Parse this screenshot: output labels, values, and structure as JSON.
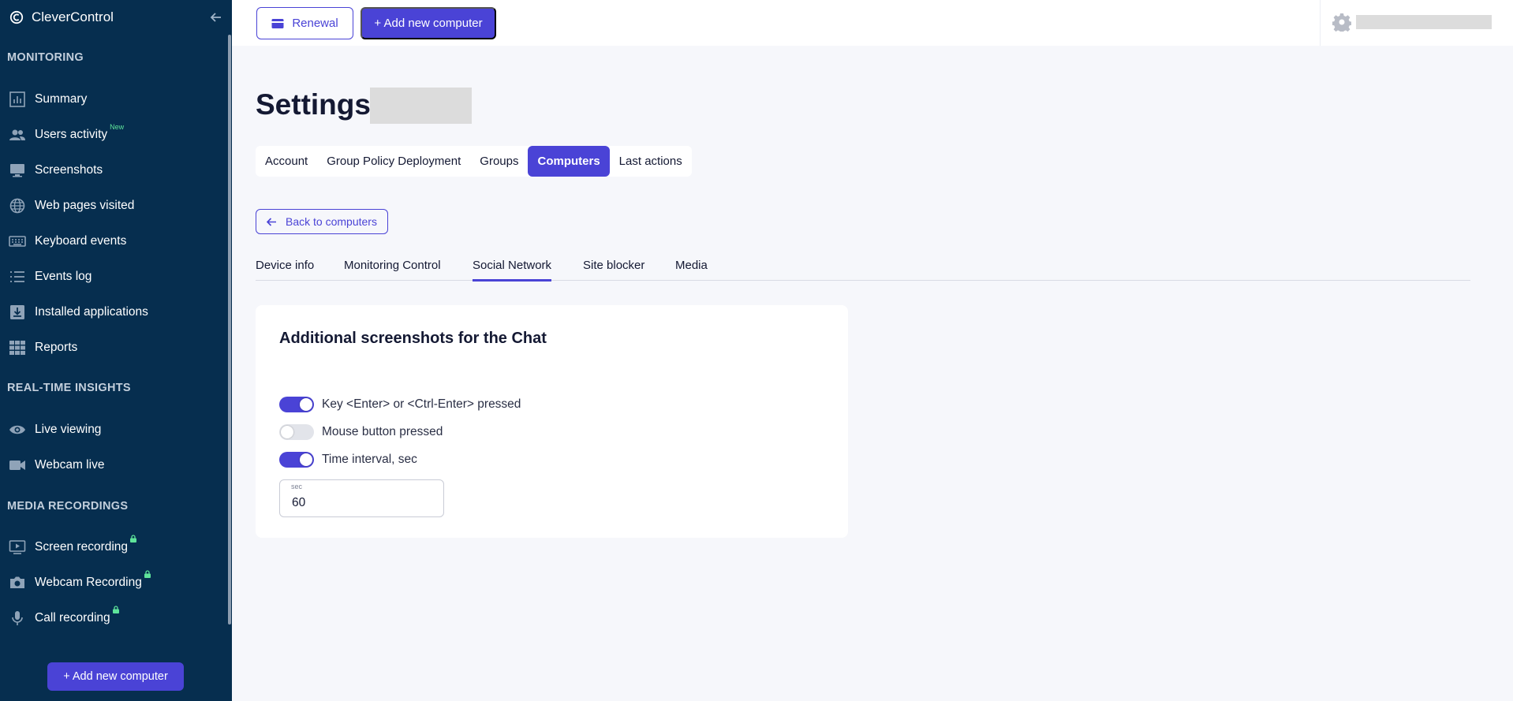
{
  "brand": {
    "name": "CleverControl"
  },
  "sidebar": {
    "sections": [
      {
        "title": "MONITORING"
      },
      {
        "title": "REAL-TIME INSIGHTS"
      },
      {
        "title": "MEDIA RECORDINGS"
      }
    ],
    "items": [
      {
        "label": "Summary",
        "icon": "chart-icon"
      },
      {
        "label": "Users activity",
        "icon": "users-icon",
        "badge": "New"
      },
      {
        "label": "Screenshots",
        "icon": "monitor-icon"
      },
      {
        "label": "Web pages visited",
        "icon": "globe-icon"
      },
      {
        "label": "Keyboard events",
        "icon": "keyboard-icon"
      },
      {
        "label": "Events log",
        "icon": "list-icon"
      },
      {
        "label": "Installed applications",
        "icon": "install-icon"
      },
      {
        "label": "Reports",
        "icon": "grid-icon"
      },
      {
        "label": "Live viewing",
        "icon": "eye-icon"
      },
      {
        "label": "Webcam live",
        "icon": "video-icon"
      },
      {
        "label": "Screen recording",
        "icon": "screen-play-icon",
        "locked": true
      },
      {
        "label": "Webcam Recording",
        "icon": "camera-icon",
        "locked": true
      },
      {
        "label": "Call recording",
        "icon": "microphone-icon",
        "locked": true
      }
    ],
    "add_button": "+ Add new computer"
  },
  "topbar": {
    "renewal_label": "Renewal",
    "add_label": "+ Add new computer"
  },
  "page": {
    "title": "Settings",
    "tabs": [
      {
        "label": "Account",
        "active": false
      },
      {
        "label": "Group Policy Deployment",
        "active": false
      },
      {
        "label": "Groups",
        "active": false
      },
      {
        "label": "Computers",
        "active": true
      },
      {
        "label": "Last actions",
        "active": false
      }
    ],
    "back_label": "Back to computers",
    "subtabs": [
      {
        "label": "Device info",
        "active": false
      },
      {
        "label": "Monitoring Control",
        "active": false
      },
      {
        "label": "Social Network",
        "active": true
      },
      {
        "label": "Site blocker",
        "active": false
      },
      {
        "label": "Media",
        "active": false
      }
    ]
  },
  "card": {
    "title": "Additional screenshots for the Chat",
    "toggles": [
      {
        "label": "Key <Enter> or <Ctrl-Enter> pressed",
        "on": true
      },
      {
        "label": "Mouse button pressed",
        "on": false
      },
      {
        "label": "Time interval, sec",
        "on": true
      }
    ],
    "interval_field": {
      "label": "sec",
      "value": "60"
    }
  },
  "colors": {
    "accent": "#4a43d6",
    "sidebar_bg": "#062e4f",
    "badge_green": "#5ee39a"
  }
}
